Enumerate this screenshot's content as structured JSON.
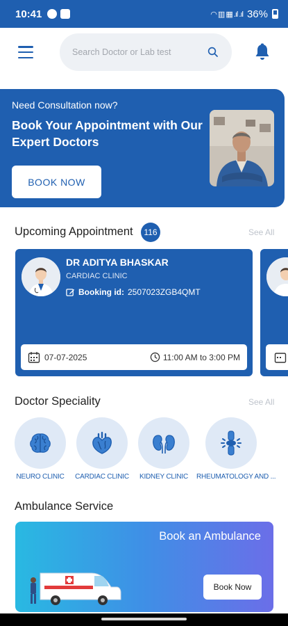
{
  "status_bar": {
    "time": "10:41",
    "battery": "36%"
  },
  "header": {
    "search_placeholder": "Search Doctor or Lab test"
  },
  "hero": {
    "subtitle": "Need Consultation now?",
    "title": "Book Your Appointment with Our Expert Doctors",
    "button": "BOOK NOW"
  },
  "upcoming": {
    "title": "Upcoming Appointment",
    "count": "116",
    "see_all": "See All",
    "cards": [
      {
        "doctor": "DR ADITYA BHASKAR",
        "clinic": "CARDIAC CLINIC",
        "booking_label": "Booking id:",
        "booking_id": "2507023ZGB4QMT",
        "date": "07-07-2025",
        "time": "11:00 AM to 3:00 PM"
      }
    ]
  },
  "speciality": {
    "title": "Doctor Speciality",
    "see_all": "See All",
    "items": [
      {
        "label": "NEURO CLINIC",
        "icon": "brain-icon"
      },
      {
        "label": "CARDIAC CLINIC",
        "icon": "heart-icon"
      },
      {
        "label": "KIDNEY CLINIC",
        "icon": "kidney-icon"
      },
      {
        "label": "RHEUMATOLOGY AND ...",
        "icon": "joint-icon"
      }
    ]
  },
  "ambulance": {
    "title": "Ambulance Service",
    "card_title": "Book an Ambulance",
    "button": "Book Now"
  },
  "colors": {
    "primary": "#1f5fb0",
    "icon_bg": "#dfe9f6"
  }
}
